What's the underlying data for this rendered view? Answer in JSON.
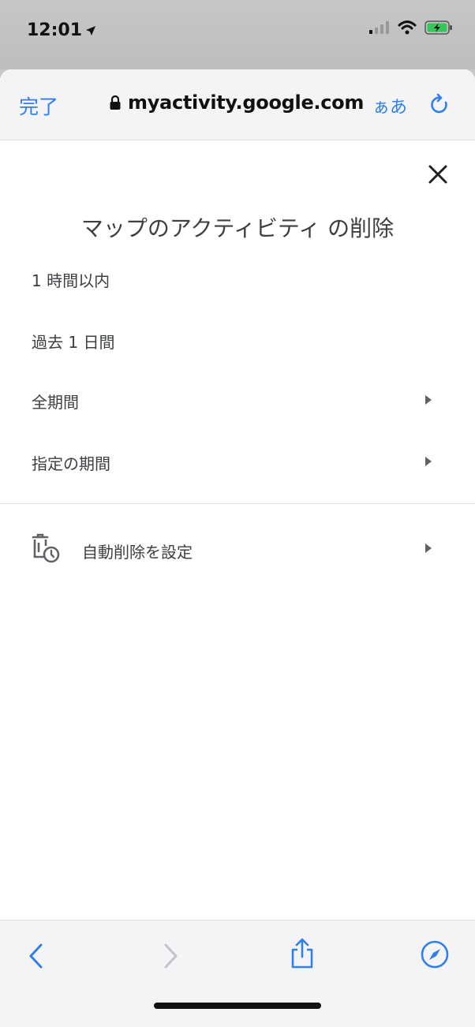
{
  "status_bar": {
    "time": "12:01"
  },
  "browser": {
    "done_label": "完了",
    "url": "myactivity.google.com",
    "text_size_label": "ぁあ"
  },
  "dialog": {
    "title": "マップのアクティビティ の削除",
    "options": [
      {
        "label": "1 時間以内",
        "has_arrow": false
      },
      {
        "label": "過去 1 日間",
        "has_arrow": false
      },
      {
        "label": "全期間",
        "has_arrow": true
      },
      {
        "label": "指定の期間",
        "has_arrow": true
      }
    ],
    "auto_delete_label": "自動削除を設定"
  },
  "colors": {
    "accent": "#2f80ed",
    "text": "#3c4043",
    "battery": "#34c759"
  }
}
